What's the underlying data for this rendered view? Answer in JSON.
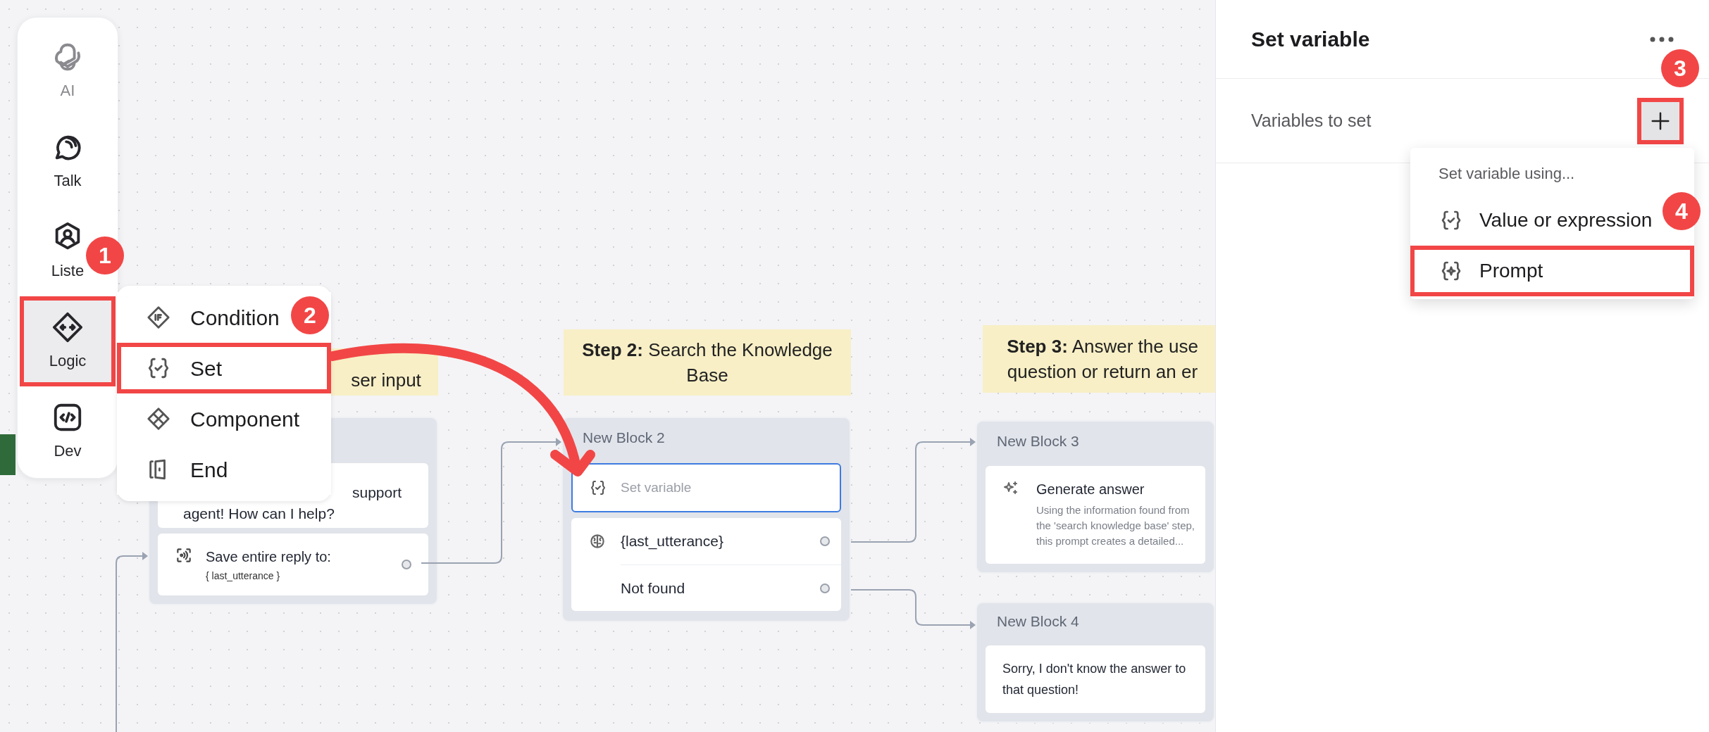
{
  "toolbar": {
    "items": [
      {
        "label": "AI",
        "selected": false,
        "muted": true,
        "highlighted": false
      },
      {
        "label": "Talk",
        "selected": false,
        "muted": false,
        "highlighted": false
      },
      {
        "label": "Liste",
        "selected": false,
        "muted": false,
        "highlighted": false
      },
      {
        "label": "Logic",
        "selected": true,
        "muted": false,
        "highlighted": true
      },
      {
        "label": "Dev",
        "selected": false,
        "muted": false,
        "highlighted": false
      }
    ]
  },
  "step_menu": {
    "items": [
      {
        "label": "Condition",
        "highlighted": false
      },
      {
        "label": "Set",
        "highlighted": true
      },
      {
        "label": "Component",
        "highlighted": false
      },
      {
        "label": "End",
        "highlighted": false
      }
    ]
  },
  "canvas": {
    "notes": [
      {
        "lines": [
          "ser input"
        ]
      },
      {
        "lines": [
          "**Step 2:** Search the Knowledge",
          "Base"
        ]
      },
      {
        "lines": [
          "**Step 3:** Answer the use",
          "question or return an er"
        ]
      }
    ],
    "blocks": [
      {
        "cards": [
          {
            "kind": "message",
            "lines": [
              "support",
              "agent! How can I help?"
            ]
          },
          {
            "kind": "capture",
            "text": "Save entire reply to:",
            "variable": "{ last_utterance }"
          }
        ]
      },
      {
        "title": "New Block 2",
        "cards": [
          {
            "kind": "set",
            "placeholder": "Set variable",
            "selected": true
          },
          {
            "kind": "knowledge",
            "paths": [
              {
                "label": "{last_utterance}"
              },
              {
                "label": "Not found"
              }
            ]
          }
        ]
      },
      {
        "title": "New Block 3",
        "cards": [
          {
            "kind": "prompt",
            "title": "Generate answer",
            "description": "Using the information found from the 'search knowledge base' step, this prompt creates a detailed..."
          }
        ]
      },
      {
        "title": "New Block 4",
        "cards": [
          {
            "kind": "message",
            "lines": [
              "Sorry, I don't know the answer to",
              "that question!"
            ]
          }
        ]
      }
    ]
  },
  "panel": {
    "title": "Set variable",
    "section": "Variables to set",
    "add_highlighted": true,
    "dropdown": {
      "heading": "Set variable using...",
      "items": [
        {
          "label": "Value or expression",
          "highlighted": false
        },
        {
          "label": "Prompt",
          "highlighted": true
        }
      ]
    }
  },
  "annotations": [
    {
      "number": "1"
    },
    {
      "number": "2"
    },
    {
      "number": "3"
    },
    {
      "number": "4"
    }
  ]
}
